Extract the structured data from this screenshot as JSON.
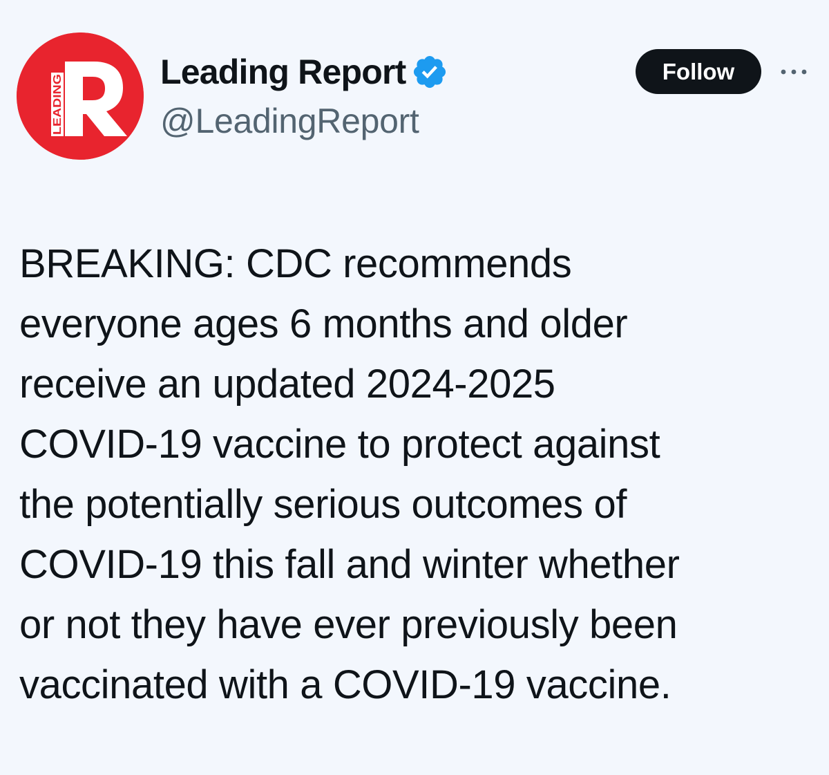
{
  "author": {
    "display_name": "Leading Report",
    "handle": "@LeadingReport",
    "avatar_icon": "leading-report-logo",
    "avatar_logo_text": "LEADING",
    "avatar_logo_letter": "R",
    "avatar_color": "#e8242e",
    "verified_badge_icon": "verified-checkmark-icon",
    "verified_color": "#1d9bf0"
  },
  "actions": {
    "follow_label": "Follow",
    "more_icon": "more-horizontal-icon"
  },
  "tweet": {
    "lines": [
      "BREAKING: CDC recommends",
      "everyone ages 6 months and older",
      "receive an updated 2024-2025",
      "COVID-19 vaccine to protect against",
      "the potentially serious outcomes of",
      "COVID-19 this fall and winter whether",
      "or not they have ever previously been",
      "vaccinated with a COVID-19 vaccine."
    ]
  },
  "colors": {
    "background": "#f3f7fd",
    "text_primary": "#0f1419",
    "text_secondary": "#536471",
    "button_bg": "#0f1419",
    "button_text": "#ffffff"
  }
}
